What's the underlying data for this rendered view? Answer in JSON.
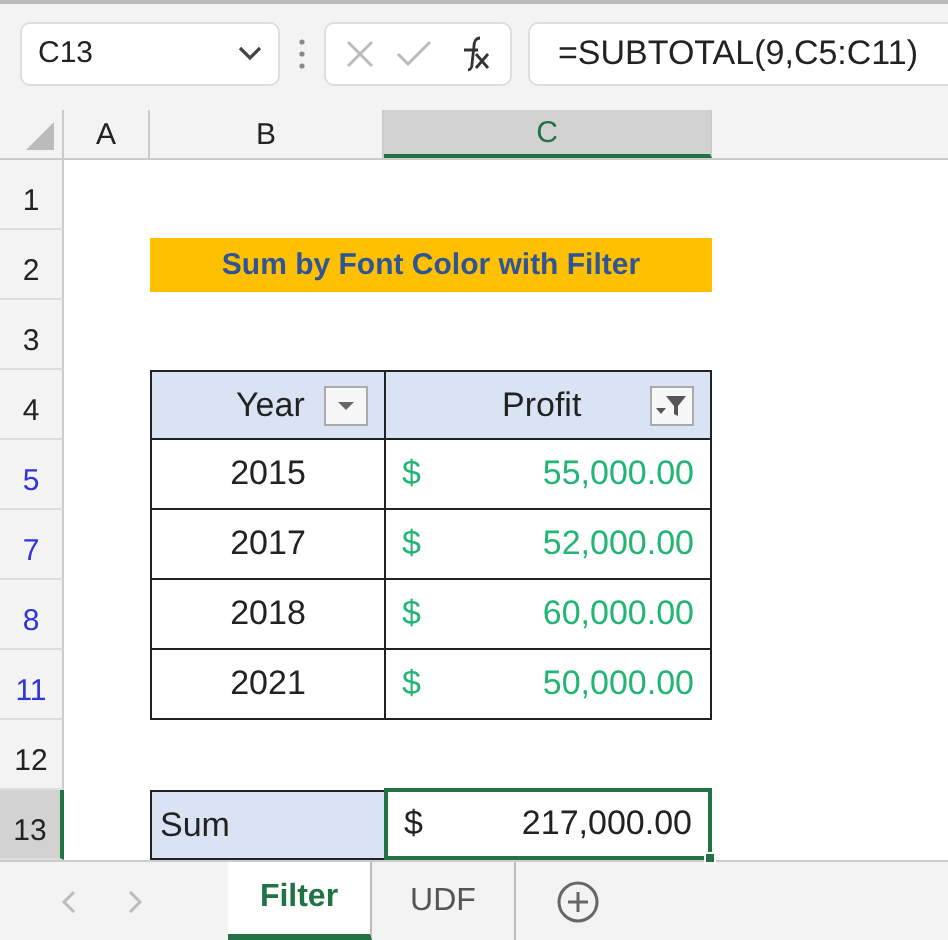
{
  "formula_bar": {
    "name_box": "C13",
    "formula": "=SUBTOTAL(9,C5:C11)"
  },
  "columns": [
    {
      "label": "A",
      "selected": false
    },
    {
      "label": "B",
      "selected": false
    },
    {
      "label": "C",
      "selected": true
    }
  ],
  "rows": [
    {
      "number": "1",
      "kind": "blank",
      "filtered": false,
      "selected": false
    },
    {
      "number": "2",
      "kind": "title",
      "filtered": false,
      "selected": false,
      "text": "Sum by Font Color with Filter"
    },
    {
      "number": "3",
      "kind": "blank",
      "filtered": false,
      "selected": false
    },
    {
      "number": "4",
      "kind": "header",
      "filtered": false,
      "selected": false,
      "year": "Year",
      "profit": "Profit",
      "year_filter_active": false,
      "profit_filter_active": true
    },
    {
      "number": "5",
      "kind": "data",
      "filtered": true,
      "selected": false,
      "year": "2015",
      "currency": "$",
      "amount": "55,000.00"
    },
    {
      "number": "7",
      "kind": "data",
      "filtered": true,
      "selected": false,
      "year": "2017",
      "currency": "$",
      "amount": "52,000.00"
    },
    {
      "number": "8",
      "kind": "data",
      "filtered": true,
      "selected": false,
      "year": "2018",
      "currency": "$",
      "amount": "60,000.00"
    },
    {
      "number": "11",
      "kind": "data",
      "filtered": true,
      "selected": false,
      "year": "2021",
      "currency": "$",
      "amount": "50,000.00"
    },
    {
      "number": "12",
      "kind": "blank",
      "filtered": false,
      "selected": false
    },
    {
      "number": "13",
      "kind": "sum",
      "filtered": false,
      "selected": true,
      "label": "Sum",
      "currency": "$",
      "amount": "217,000.00"
    }
  ],
  "sheet_tabs": [
    {
      "label": "Filter",
      "selected": true
    },
    {
      "label": "UDF",
      "selected": false
    }
  ]
}
